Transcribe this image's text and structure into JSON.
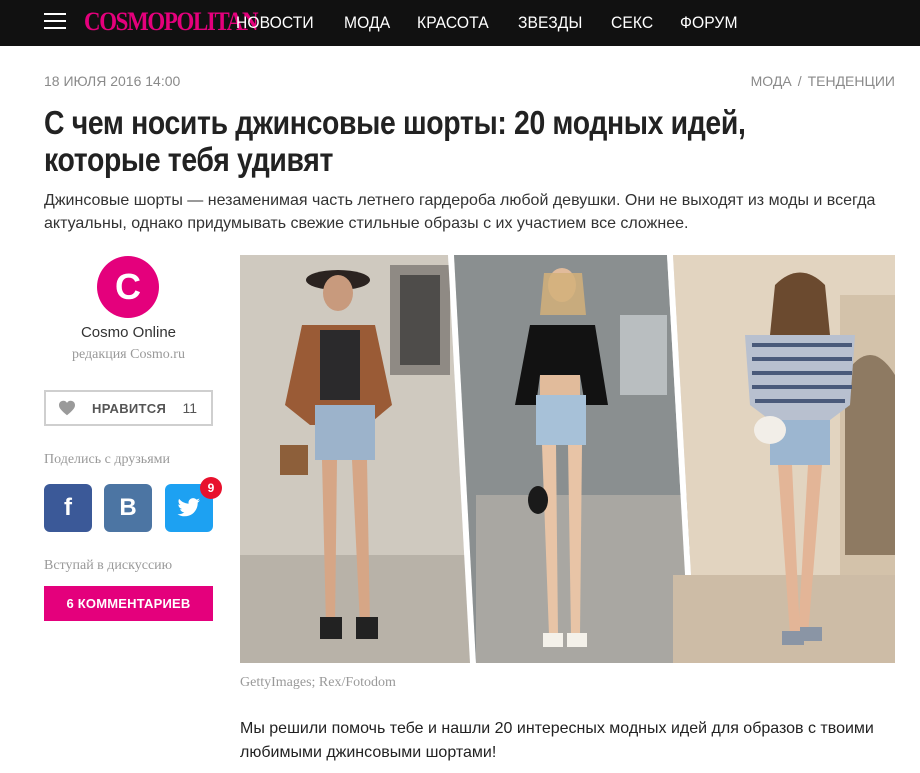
{
  "header": {
    "logo": "COSMOPOLITAN",
    "nav": [
      "НОВОСТИ",
      "МОДА",
      "КРАСОТА",
      "ЗВЕЗДЫ",
      "СЕКС",
      "ФОРУМ"
    ]
  },
  "article": {
    "date": "18 ИЮЛЯ 2016 14:00",
    "breadcrumbs": [
      "МОДА",
      "ТЕНДЕНЦИИ"
    ],
    "title": "С чем носить джинсовые шорты: 20 модных идей, которые тебя удивят",
    "lead": "Джинсовые шорты — незаменимая часть летнего гардероба любой девушки. Они не выходят из моды и всегда актуальны, однако придумывать свежие стильные образы с их участием все сложнее.",
    "photo_caption": "GettyImages; Rex/Fotodom",
    "body": "Мы решили помочь тебе и нашли 20 интересных модных идей для образов с твоими любимыми джинсовыми шортами!"
  },
  "sidebar": {
    "avatar_letter": "C",
    "author": "Cosmo Online",
    "author_role": "редакция Cosmo.ru",
    "like_label": "НРАВИТСЯ",
    "like_count": "11",
    "share_label": "Поделись с друзьями",
    "share": {
      "facebook": "f",
      "vk": "B",
      "twitter_badge": "9"
    },
    "discussion_label": "Вступай в дискуссию",
    "comments_button": "6 КОММЕНТАРИЕВ"
  },
  "colors": {
    "brand": "#e4007c",
    "topbar": "#111111",
    "facebook": "#3b5998",
    "vk": "#4c75a3",
    "twitter": "#1da1f2"
  },
  "icons": [
    "menu-icon",
    "heart-icon",
    "twitter-bird-icon"
  ]
}
